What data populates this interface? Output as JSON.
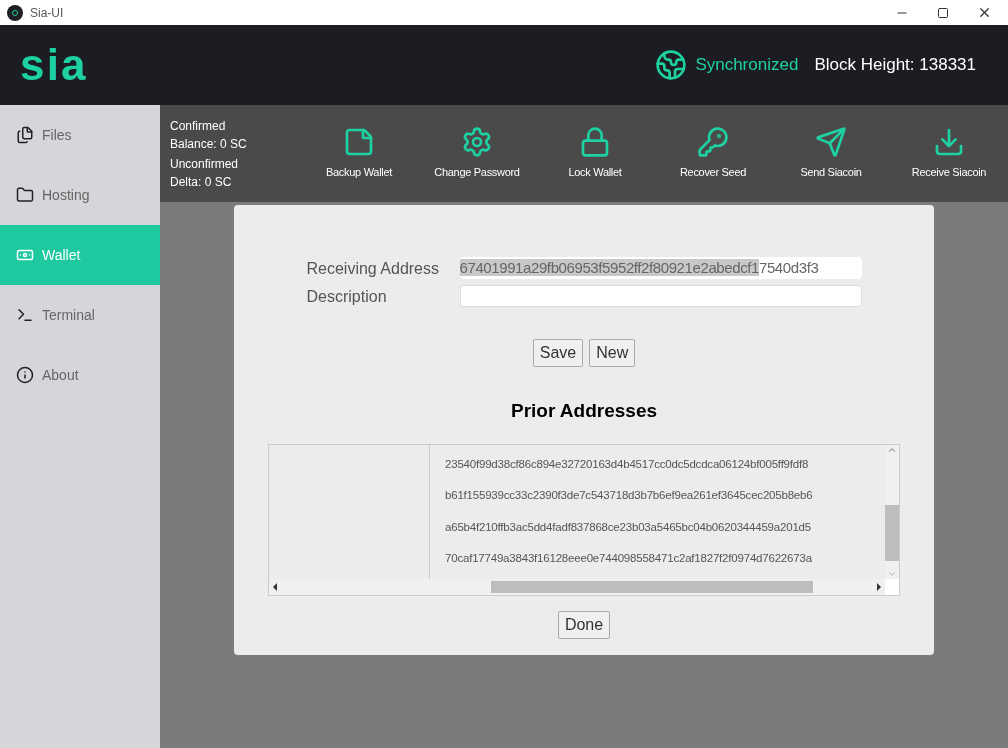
{
  "window": {
    "title": "Sia-UI"
  },
  "header": {
    "logo": "sia",
    "sync_status": "Synchronized",
    "block_height": "Block Height: 138331"
  },
  "sidebar": {
    "items": [
      {
        "label": "Files",
        "selected": false
      },
      {
        "label": "Hosting",
        "selected": false
      },
      {
        "label": "Wallet",
        "selected": true
      },
      {
        "label": "Terminal",
        "selected": false
      },
      {
        "label": "About",
        "selected": false
      }
    ]
  },
  "balance": [
    "Confirmed",
    "Balance: 0 SC",
    "Unconfirmed",
    "Delta: 0 SC"
  ],
  "toolbar": [
    "Backup Wallet",
    "Change Password",
    "Lock Wallet",
    "Recover Seed",
    "Send Siacoin",
    "Receive Siacoin"
  ],
  "dialog": {
    "fields": [
      {
        "label": "Receiving Address",
        "selected_text": "67401991a29fb06953f5952ff2f80921e2abedcf1",
        "unselected_text": "7540d3f3"
      },
      {
        "label": "Description"
      }
    ],
    "buttons": [
      "Save",
      "New"
    ],
    "prior_title": "Prior Addresses",
    "prior_addresses": [
      "23540f99d38cf86c894e32720163d4b4517cc0dc5dcdca06124bf005ff9fdf8",
      "b61f155939cc33c2390f3de7c543718d3b7b6ef9ea261ef3645cec205b8eb6",
      "a65b4f210ffb3ac5dd4fadf837868ce23b03a5465bc04b0620344459a201d5",
      "70caf17749a3843f16128eee0e744098558471c2af1827f2f0974d7622673a"
    ],
    "done": "Done"
  }
}
